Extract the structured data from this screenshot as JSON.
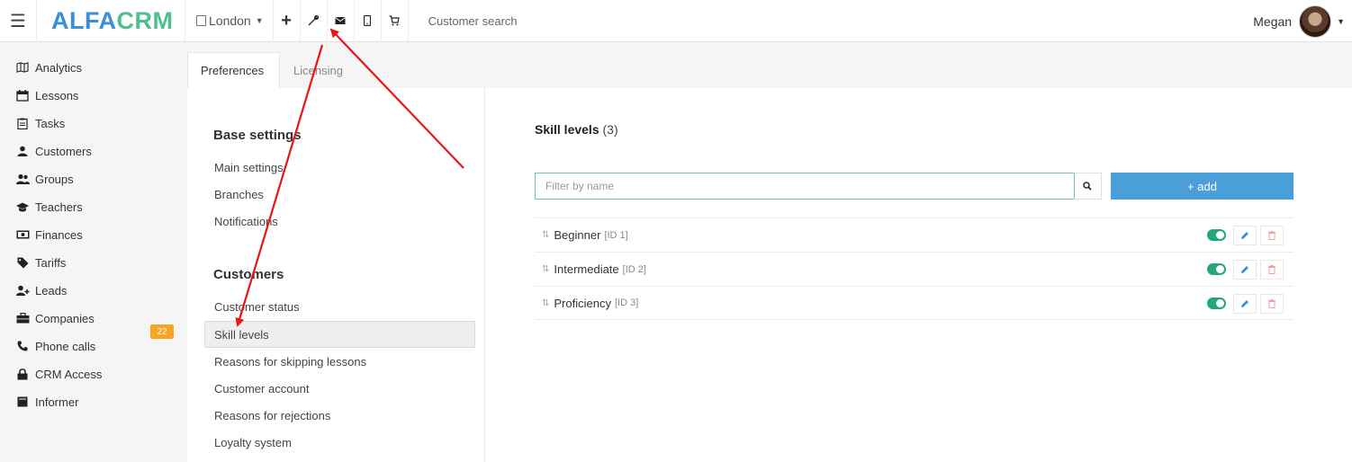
{
  "header": {
    "logo_alfa": "ALFA",
    "logo_crm": "CRM",
    "branch": "London",
    "search_label": "Customer search",
    "user_name": "Megan"
  },
  "sidebar": {
    "items": [
      {
        "label": "Analytics",
        "icon": "map-icon"
      },
      {
        "label": "Lessons",
        "icon": "calendar-icon"
      },
      {
        "label": "Tasks",
        "icon": "clipboard-icon"
      },
      {
        "label": "Customers",
        "icon": "user-icon"
      },
      {
        "label": "Groups",
        "icon": "users-icon"
      },
      {
        "label": "Teachers",
        "icon": "graduation-cap-icon"
      },
      {
        "label": "Finances",
        "icon": "money-icon"
      },
      {
        "label": "Tariffs",
        "icon": "tag-icon"
      },
      {
        "label": "Leads",
        "icon": "user-plus-icon"
      },
      {
        "label": "Companies",
        "icon": "briefcase-icon"
      },
      {
        "label": "Phone calls",
        "icon": "phone-icon"
      },
      {
        "label": "CRM Access",
        "icon": "lock-icon"
      },
      {
        "label": "Informer",
        "icon": "book-icon"
      }
    ],
    "leads_badge": "22"
  },
  "tabs": [
    {
      "label": "Preferences",
      "active": true
    },
    {
      "label": "Licensing",
      "active": false
    }
  ],
  "menu": {
    "base_heading": "Base settings",
    "base_items": [
      "Main settings",
      "Branches",
      "Notifications"
    ],
    "customers_heading": "Customers",
    "customer_items": [
      "Customer status",
      "Skill levels",
      "Reasons for skipping lessons",
      "Customer account",
      "Reasons for rejections",
      "Loyalty system"
    ],
    "active_item": "Skill levels"
  },
  "content": {
    "title": "Skill levels",
    "count": "(3)",
    "filter_placeholder": "Filter by name",
    "add_label": "+ add",
    "rows": [
      {
        "name": "Beginner",
        "id": "[ID 1]",
        "enabled": true
      },
      {
        "name": "Intermediate",
        "id": "[ID 2]",
        "enabled": true
      },
      {
        "name": "Proficiency",
        "id": "[ID 3]",
        "enabled": true
      }
    ]
  },
  "colors": {
    "brand_blue": "#3a8fd6",
    "brand_green": "#4fc08d",
    "accent_button": "#4a9fd8",
    "toggle_on": "#21a67d",
    "badge": "#f6a623",
    "annotation_arrow": "#e8161a"
  }
}
